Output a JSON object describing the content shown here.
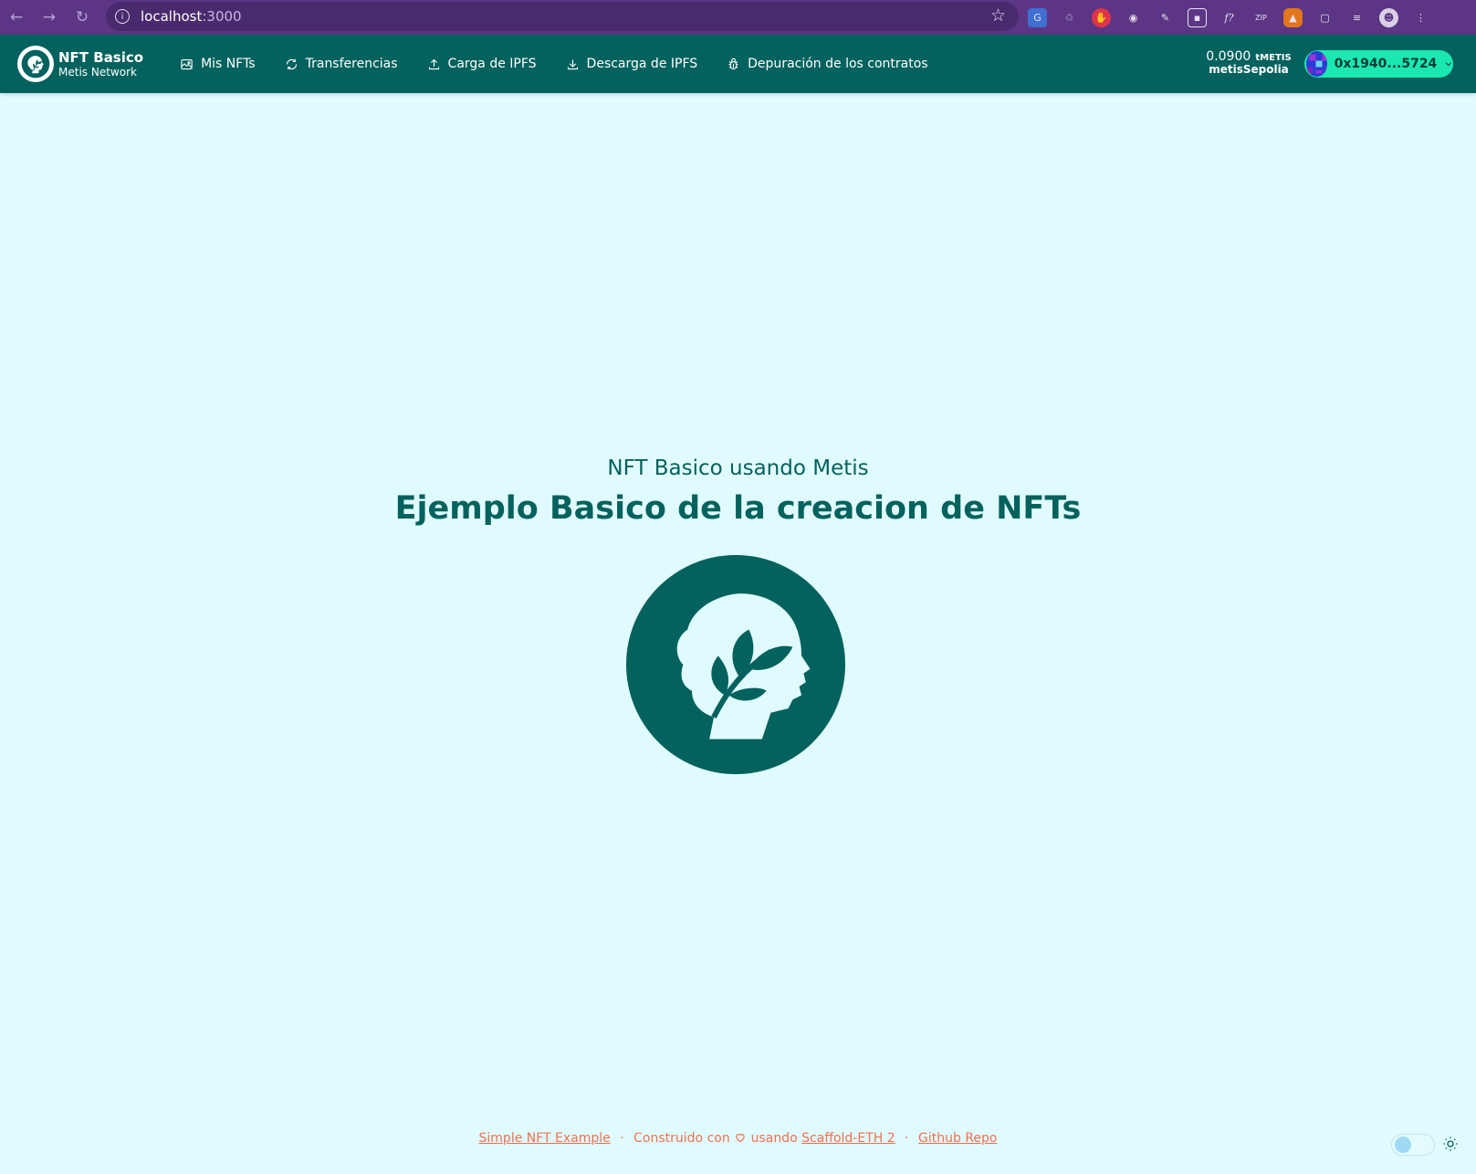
{
  "browser": {
    "url_host": "localhost",
    "url_port": ":3000",
    "icons": [
      "back-icon",
      "forward-icon",
      "reload-icon",
      "info-icon",
      "star-icon"
    ],
    "extensions": [
      "translate-icon",
      "recycle-icon",
      "stop-icon",
      "camera-icon",
      "pen-icon",
      "picture-in-picture-icon",
      "formula-icon",
      "zip-icon",
      "metamask-icon",
      "puzzle-icon",
      "reading-list-icon",
      "profile-icon",
      "menu-icon"
    ],
    "ext_labels": {
      "formula": "f?",
      "zip": "ZIP"
    }
  },
  "header": {
    "brand_title": "NFT Basico",
    "brand_subtitle": "Metis Network",
    "nav": [
      {
        "label": "Mis NFTs",
        "icon": "image-icon"
      },
      {
        "label": "Transferencias",
        "icon": "refresh-icon"
      },
      {
        "label": "Carga de IPFS",
        "icon": "upload-icon"
      },
      {
        "label": "Descarga de IPFS",
        "icon": "download-icon"
      },
      {
        "label": "Depuración de los contratos",
        "icon": "bug-icon"
      }
    ],
    "balance_amount": "0.0900",
    "balance_unit": "tMETIS",
    "network": "metisSepolia",
    "wallet_address": "0x1940...5724"
  },
  "hero": {
    "subtitle": "NFT Basico usando Metis",
    "title": "Ejemplo Basico de la creacion de NFTs"
  },
  "footer": {
    "link1": "Simple NFT Example",
    "built_prefix": "Construido con",
    "built_suffix": "usando",
    "link2": "Scaffold-ETH 2",
    "link3": "Github Repo",
    "dot": "·"
  },
  "colors": {
    "header_bg": "#04625e",
    "page_bg": "#e0fbfe",
    "accent": "#1be8b0",
    "footer_link": "#f0714f",
    "chrome_bg": "#5c3685"
  }
}
